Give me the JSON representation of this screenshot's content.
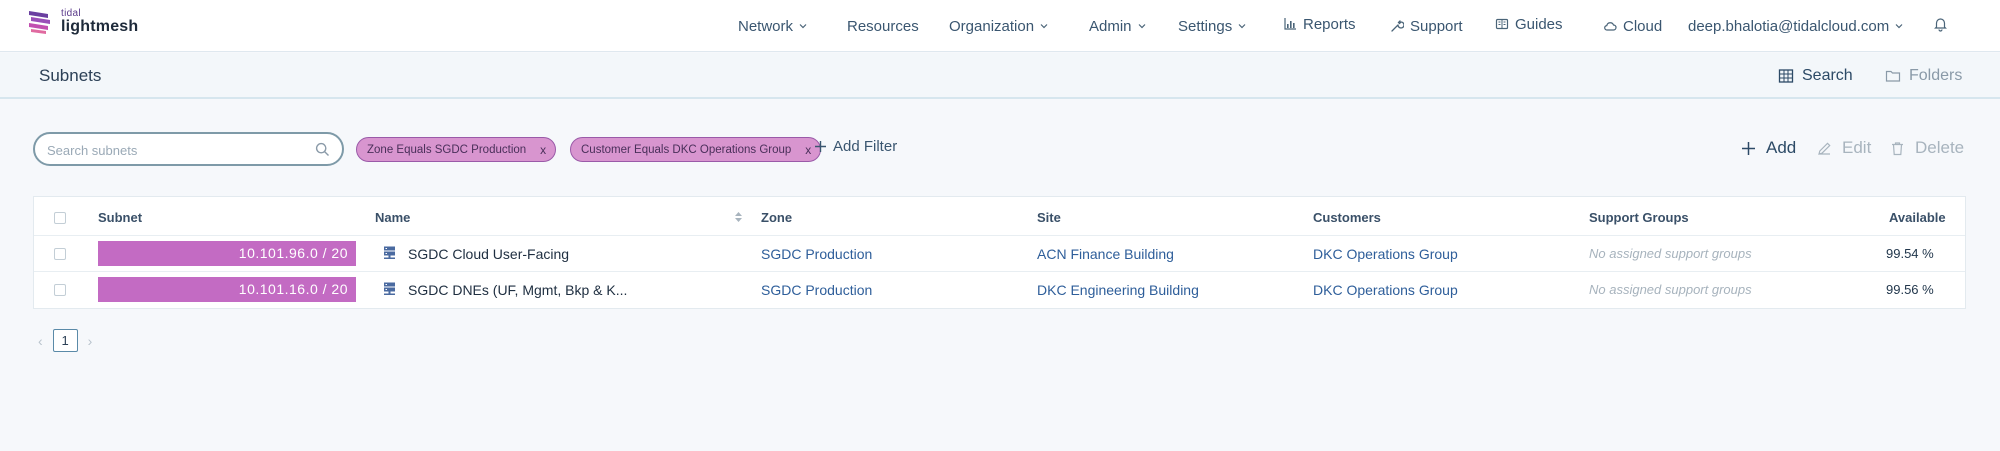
{
  "brand": {
    "small": "tidal",
    "big": "lightmesh"
  },
  "nav": {
    "network": "Network",
    "resources": "Resources",
    "organization": "Organization",
    "admin": "Admin",
    "settings": "Settings",
    "reports": "Reports",
    "support": "Support",
    "guides": "Guides",
    "cloud": "Cloud",
    "user": "deep.bhalotia@tidalcloud.com"
  },
  "page": {
    "title": "Subnets",
    "views": {
      "search": "Search",
      "folders": "Folders"
    }
  },
  "toolbar": {
    "search_placeholder": "Search subnets",
    "filters": [
      {
        "label": "Zone Equals SGDC Production",
        "remove": "x"
      },
      {
        "label": "Customer Equals DKC Operations Group",
        "remove": "x"
      }
    ],
    "add_filter": "Add Filter",
    "actions": {
      "add": "Add",
      "edit": "Edit",
      "delete": "Delete"
    }
  },
  "table": {
    "columns": {
      "subnet": "Subnet",
      "name": "Name",
      "zone": "Zone",
      "site": "Site",
      "customers": "Customers",
      "support_groups": "Support Groups",
      "available": "Available"
    },
    "rows": [
      {
        "subnet": "10.101.96.0 / 20",
        "name": "SGDC Cloud User-Facing",
        "zone": "SGDC Production",
        "site": "ACN Finance Building",
        "customers": "DKC Operations Group",
        "support_groups": "No assigned support groups",
        "available": "99.54 %"
      },
      {
        "subnet": "10.101.16.0 / 20",
        "name": "SGDC DNEs (UF, Mgmt, Bkp & K...",
        "zone": "SGDC Production",
        "site": "DKC Engineering Building",
        "customers": "DKC Operations Group",
        "support_groups": "No assigned support groups",
        "available": "99.56 %"
      }
    ]
  },
  "pagination": {
    "prev": "‹",
    "current": "1",
    "next": "›"
  },
  "colors": {
    "subnet_bar": "#c36bc3",
    "chip_bg": "#d895cf",
    "link": "#2e5e9a",
    "brand_purple": "#5a3a8a"
  },
  "icons": [
    "logo-mark-icon",
    "chevron-down-icon",
    "bar-chart-icon",
    "wrench-icon",
    "book-icon",
    "cloud-icon",
    "bell-icon",
    "table-icon",
    "folder-icon",
    "search-icon",
    "plus-icon",
    "pencil-icon",
    "trash-icon",
    "server-icon",
    "sort-icon"
  ]
}
